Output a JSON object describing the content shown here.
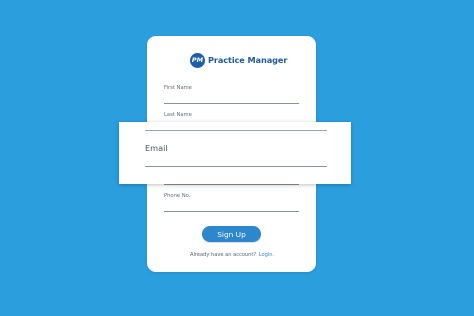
{
  "app": {
    "name": "Practice Manager",
    "logo_text": "PM"
  },
  "form": {
    "first_name_label": "First Name",
    "last_name_label": "Last Name",
    "email_label": "Email",
    "phone_label": "Phone No."
  },
  "actions": {
    "signup_label": "Sign Up"
  },
  "footer": {
    "prompt": "Already have an account?",
    "login_label": "Login."
  },
  "colors": {
    "background": "#2b9fde",
    "brand": "#1f5a9c",
    "button": "#2e87cc"
  }
}
